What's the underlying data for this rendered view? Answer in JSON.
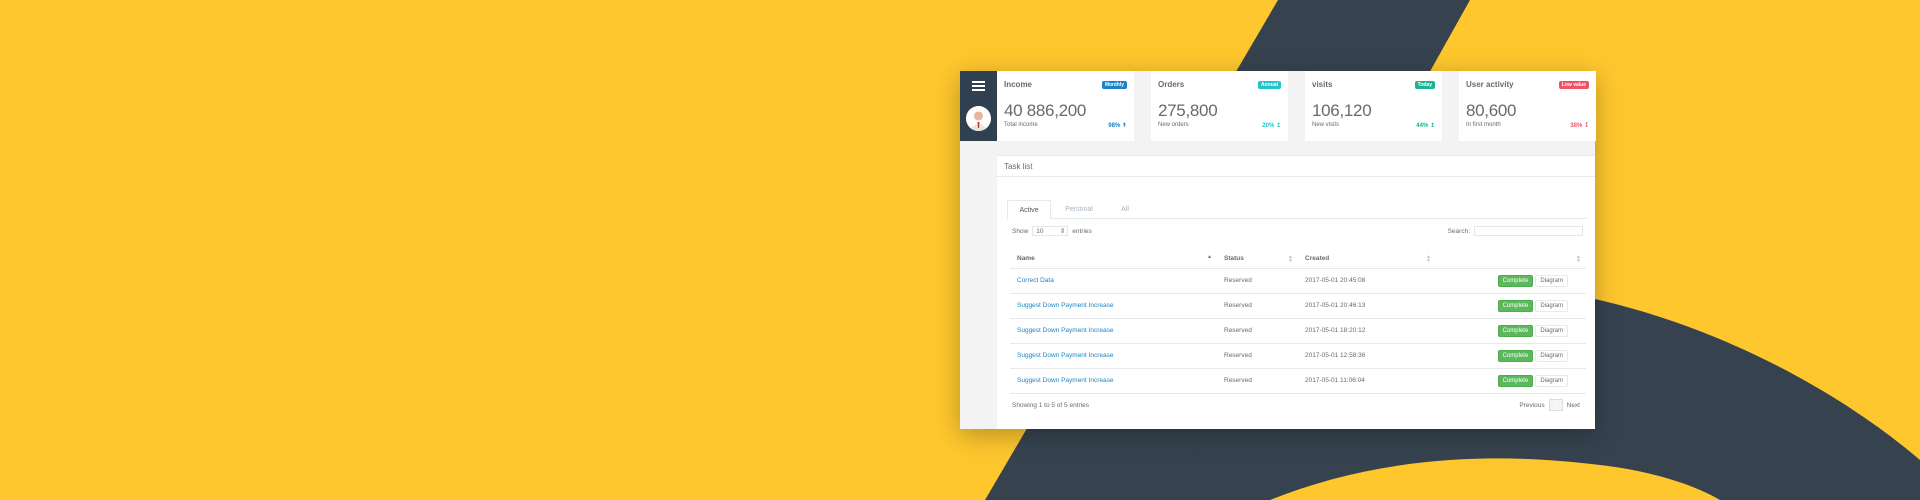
{
  "colors": {
    "background": "#fec72e",
    "dark_shape": "#2f4050",
    "sidebar": "#2f4050",
    "link": "#1c84c6",
    "complete": "#5cb85c"
  },
  "sidebar": {
    "menu_icon": "hamburger-icon",
    "avatar_icon": "user-avatar"
  },
  "stats": [
    {
      "title": "Income",
      "badge": "Monthly",
      "badge_color": "#1c84c6",
      "value": "40 886,200",
      "sub": "Total income",
      "pct": "98%",
      "pct_color": "#1c84c6",
      "arrow": "up-bolt-icon"
    },
    {
      "title": "Orders",
      "badge": "Annual",
      "badge_color": "#23c6c8",
      "value": "275,800",
      "sub": "New orders",
      "pct": "20%",
      "pct_color": "#23c6c8",
      "arrow": "up-arrow-icon"
    },
    {
      "title": "visits",
      "badge": "Today",
      "badge_color": "#1ab394",
      "value": "106,120",
      "sub": "New visits",
      "pct": "44%",
      "pct_color": "#1ab394",
      "arrow": "up-arrow-icon"
    },
    {
      "title": "User activity",
      "badge": "Low value",
      "badge_color": "#ed5565",
      "value": "80,600",
      "sub": "In first month",
      "pct": "38%",
      "pct_color": "#ed5565",
      "arrow": "down-arrow-icon"
    }
  ],
  "tasks": {
    "title": "Task list",
    "tabs": [
      "Active",
      "Personal",
      "All"
    ],
    "active_tab": "Active",
    "show_label": "Show",
    "entries_value": "10",
    "entries_label": "entries",
    "search_label": "Search:",
    "search_value": "",
    "columns": [
      "Name",
      "Status",
      "Created",
      ""
    ],
    "rows": [
      {
        "name": "Correct Data",
        "status": "Reserved",
        "created": "2017-05-01 20:45:08"
      },
      {
        "name": "Suggest Down Payment Increase",
        "status": "Reserved",
        "created": "2017-05-01 20:46:13"
      },
      {
        "name": "Suggest Down Payment Increase",
        "status": "Reserved",
        "created": "2017-05-01 18:20:12"
      },
      {
        "name": "Suggest Down Payment Increase",
        "status": "Reserved",
        "created": "2017-05-01 12:58:36"
      },
      {
        "name": "Suggest Down Payment Increase",
        "status": "Reserved",
        "created": "2017-05-01 11:06:04"
      }
    ],
    "complete_label": "Complete",
    "diagram_label": "Diagram",
    "info": "Showing 1 to 5 of 5 entries",
    "pager": {
      "previous": "Previous",
      "current": "1",
      "next": "Next"
    }
  }
}
